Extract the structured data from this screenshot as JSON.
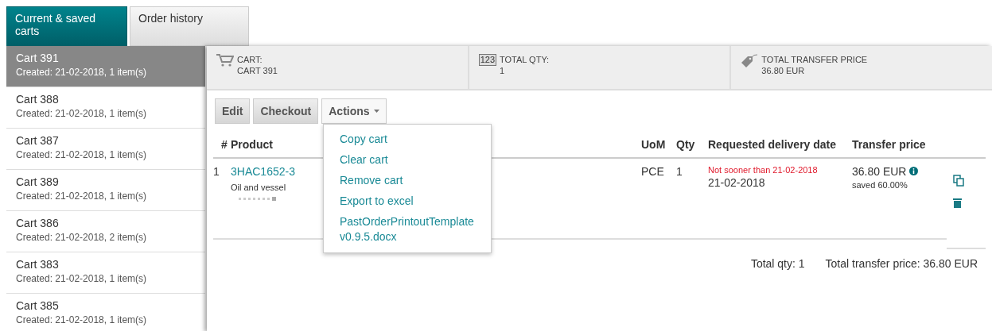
{
  "tabs": [
    {
      "label": "Current & saved carts",
      "selected": true
    },
    {
      "label": "Order history",
      "selected": false
    }
  ],
  "carts": [
    {
      "name": "Cart 391",
      "info": "Created: 21-02-2018, 1 item(s)",
      "selected": true
    },
    {
      "name": "Cart 388",
      "info": "Created: 21-02-2018, 1 item(s)",
      "selected": false
    },
    {
      "name": "Cart 387",
      "info": "Created: 21-02-2018, 1 item(s)",
      "selected": false
    },
    {
      "name": "Cart 389",
      "info": "Created: 21-02-2018, 1 item(s)",
      "selected": false
    },
    {
      "name": "Cart 386",
      "info": "Created: 21-02-2018, 2 item(s)",
      "selected": false
    },
    {
      "name": "Cart 383",
      "info": "Created: 21-02-2018, 1 item(s)",
      "selected": false
    },
    {
      "name": "Cart 385",
      "info": "Created: 21-02-2018, 1 item(s)",
      "selected": false
    }
  ],
  "summary": [
    {
      "kind": "cart",
      "label": "CART:",
      "value": "CART 391"
    },
    {
      "kind": "qty",
      "icon_text": "123",
      "label": "TOTAL QTY:",
      "value": "1"
    },
    {
      "kind": "price",
      "label": "TOTAL TRANSFER PRICE",
      "value": "36.80 EUR"
    }
  ],
  "buttons": [
    "Edit",
    "Checkout"
  ],
  "actions": {
    "label": "Actions",
    "expanded": true,
    "items": [
      "Copy cart",
      "Clear cart",
      "Remove cart",
      "Export to excel",
      "PastOrderPrintoutTemplate v0.9.5.docx"
    ]
  },
  "table": {
    "columns": [
      "#",
      "Product",
      "UoM",
      "Qty",
      "Requested delivery date",
      "Transfer price"
    ],
    "rows": [
      {
        "index": "1",
        "product": "3HAC1652-3",
        "description": "Oil and vessel",
        "uom": "PCE",
        "qty": "1",
        "date_note": "Not sooner than 21-02-2018",
        "date": "21-02-2018",
        "price": "36.80 EUR",
        "saved": "saved 60.00%"
      }
    ]
  },
  "totals": {
    "qty": "Total qty: 1",
    "price": "Total transfer price: 36.80 EUR"
  }
}
